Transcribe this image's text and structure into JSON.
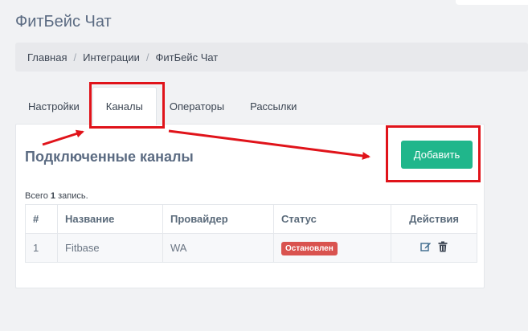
{
  "header": {
    "title": "ФитБейс Чат"
  },
  "breadcrumb": {
    "items": [
      "Главная",
      "Интеграции",
      "ФитБейс Чат"
    ]
  },
  "tabs": [
    {
      "label": "Настройки",
      "active": false
    },
    {
      "label": "Каналы",
      "active": true
    },
    {
      "label": "Операторы",
      "active": false
    },
    {
      "label": "Рассылки",
      "active": false
    }
  ],
  "panel": {
    "title": "Подключенные каналы",
    "add_label": "Добавить",
    "summary_prefix": "Всего",
    "summary_count": "1",
    "summary_suffix": "запись."
  },
  "table": {
    "columns": [
      "#",
      "Название",
      "Провайдер",
      "Статус",
      "Действия"
    ],
    "rows": [
      {
        "num": "1",
        "name": "Fitbase",
        "provider": "WA",
        "status": "Остановлен"
      }
    ]
  },
  "colors": {
    "accent": "#20b68b",
    "status_stopped": "#d9534f",
    "annotation": "#e0131a"
  }
}
